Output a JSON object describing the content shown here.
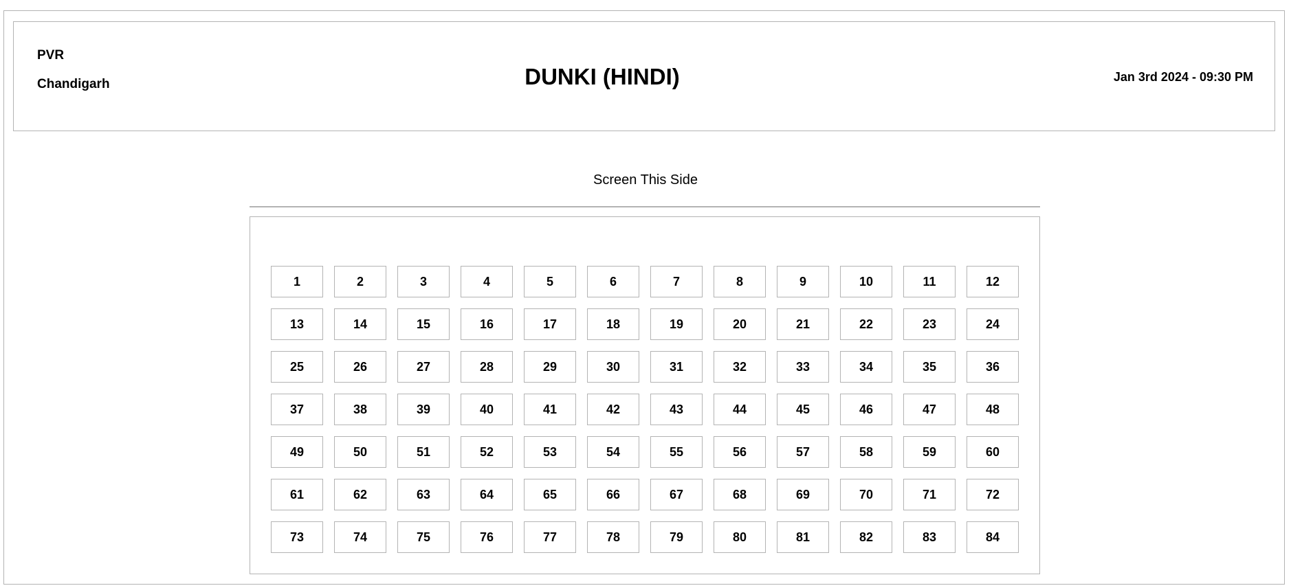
{
  "header": {
    "venue_name": "PVR",
    "venue_city": "Chandigarh",
    "movie_title": "DUNKI (HINDI)",
    "showtime": "Jan 3rd 2024 - 09:30 PM"
  },
  "screen": {
    "label": "Screen This Side"
  },
  "seats": [
    "1",
    "2",
    "3",
    "4",
    "5",
    "6",
    "7",
    "8",
    "9",
    "10",
    "11",
    "12",
    "13",
    "14",
    "15",
    "16",
    "17",
    "18",
    "19",
    "20",
    "21",
    "22",
    "23",
    "24",
    "25",
    "26",
    "27",
    "28",
    "29",
    "30",
    "31",
    "32",
    "33",
    "34",
    "35",
    "36",
    "37",
    "38",
    "39",
    "40",
    "41",
    "42",
    "43",
    "44",
    "45",
    "46",
    "47",
    "48",
    "49",
    "50",
    "51",
    "52",
    "53",
    "54",
    "55",
    "56",
    "57",
    "58",
    "59",
    "60",
    "61",
    "62",
    "63",
    "64",
    "65",
    "66",
    "67",
    "68",
    "69",
    "70",
    "71",
    "72",
    "73",
    "74",
    "75",
    "76",
    "77",
    "78",
    "79",
    "80",
    "81",
    "82",
    "83",
    "84"
  ]
}
